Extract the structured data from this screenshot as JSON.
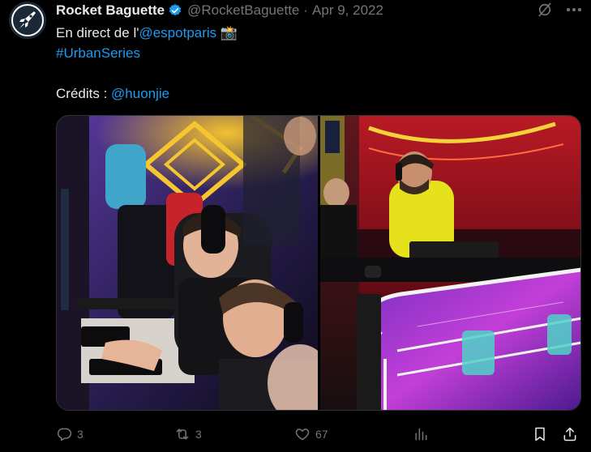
{
  "tweet": {
    "author_name": "Rocket Baguette",
    "author_handle": "@RocketBaguette",
    "separator": "·",
    "date": "Apr 9, 2022",
    "line1_prefix": "En direct de l'",
    "line1_mention": "@espotparis",
    "line1_emoji": "📸",
    "hashtag": "#UrbanSeries",
    "credits_label": "Crédits : ",
    "credits_mention": "@huonjie"
  },
  "actions": {
    "replies": "3",
    "retweets": "3",
    "likes": "67"
  },
  "colors": {
    "background": "#000000",
    "text": "#e7e9ea",
    "muted": "#71767b",
    "link": "#1d9bf0",
    "verified": "#1d9bf0"
  },
  "icons": {
    "verified": "verified-badge-icon",
    "grok": "grok-icon",
    "more": "more-icon",
    "reply": "reply-icon",
    "retweet": "retweet-icon",
    "like": "heart-icon",
    "views": "views-icon",
    "bookmark": "bookmark-icon",
    "share": "share-icon"
  }
}
